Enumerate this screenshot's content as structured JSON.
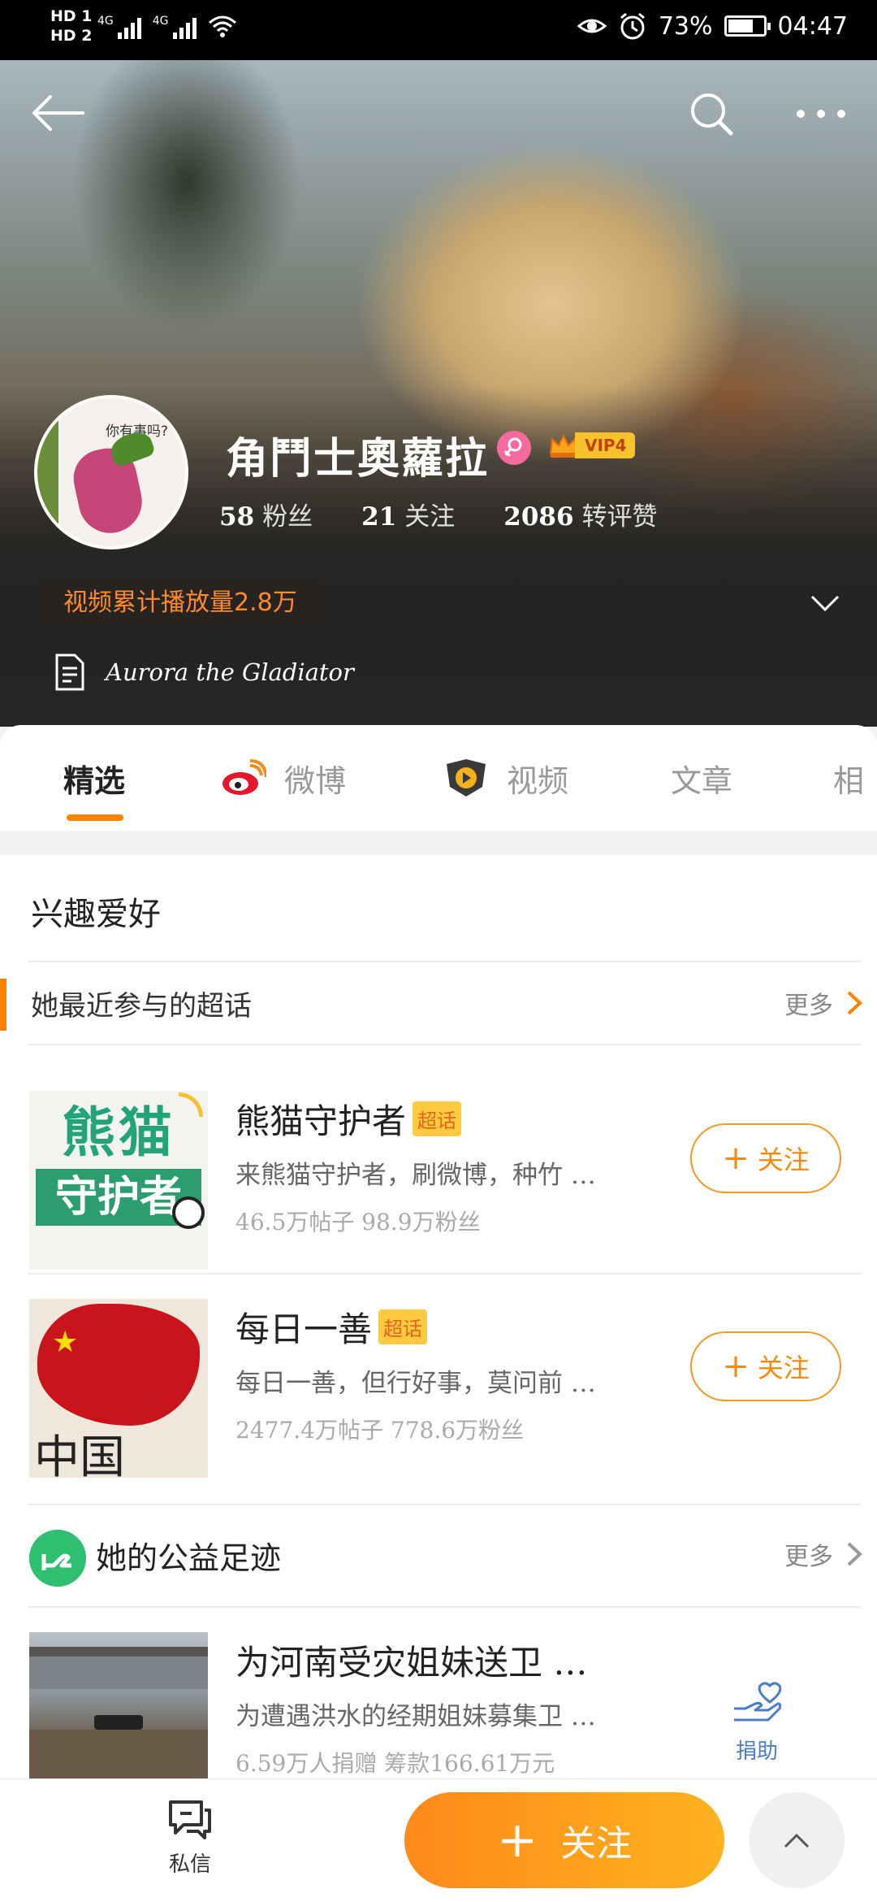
{
  "status_bar": {
    "hd1": "HD 1",
    "hd2": "HD 2",
    "net1": "4G",
    "net2": "4G",
    "battery": "73%",
    "battery_level": 0.73,
    "time": "04:47"
  },
  "profile": {
    "username": "角鬥士奧蘿拉",
    "vip": "VIP4",
    "avatar_caption": "你有事吗?",
    "stats": [
      {
        "num": "58",
        "label": "粉丝"
      },
      {
        "num": "21",
        "label": "关注"
      },
      {
        "num": "2086",
        "label": "转评赞"
      }
    ],
    "play_count": "视频累计播放量2.8万",
    "bio": "Aurora the Gladiator"
  },
  "tabs": [
    {
      "label": "精选",
      "active": true
    },
    {
      "label": "微博",
      "active": false
    },
    {
      "label": "视频",
      "active": false
    },
    {
      "label": "文章",
      "active": false
    },
    {
      "label": "相",
      "active": false
    }
  ],
  "content": {
    "section_title": "兴趣爱好",
    "super_topics": {
      "title": "她最近参与的超话",
      "more": "更多",
      "items": [
        {
          "name": "熊猫守护者",
          "tag": "超话",
          "desc": "来熊猫守护者，刷微博，种竹 …",
          "meta": "46.5万帖子 98.9万粉丝",
          "thumb_text1": "熊猫",
          "thumb_text2": "守护者",
          "button": "关注"
        },
        {
          "name": "每日一善",
          "tag": "超话",
          "desc": "每日一善，但行好事，莫问前 …",
          "meta": "2477.4万帖子 778.6万粉丝",
          "thumb_text": "中国",
          "button": "关注"
        }
      ]
    },
    "charity": {
      "title": "她的公益足迹",
      "more": "更多",
      "item": {
        "title": "为河南受灾姐妹送卫 …",
        "desc": "为遭遇洪水的经期姐妹募集卫 …",
        "meta": "6.59万人捐赠  筹款166.61万元",
        "action": "捐助"
      }
    }
  },
  "bottom_bar": {
    "message": "私信",
    "follow": "关注"
  },
  "colors": {
    "accent": "#ff8200",
    "follow_gradient_start": "#ff8a1a",
    "follow_gradient_end": "#ffb21e",
    "play_count": "#ff8a2a",
    "tag_bg": "#ffc940",
    "charity_green": "#2fbf71",
    "donate_blue": "#4a7cc9"
  }
}
